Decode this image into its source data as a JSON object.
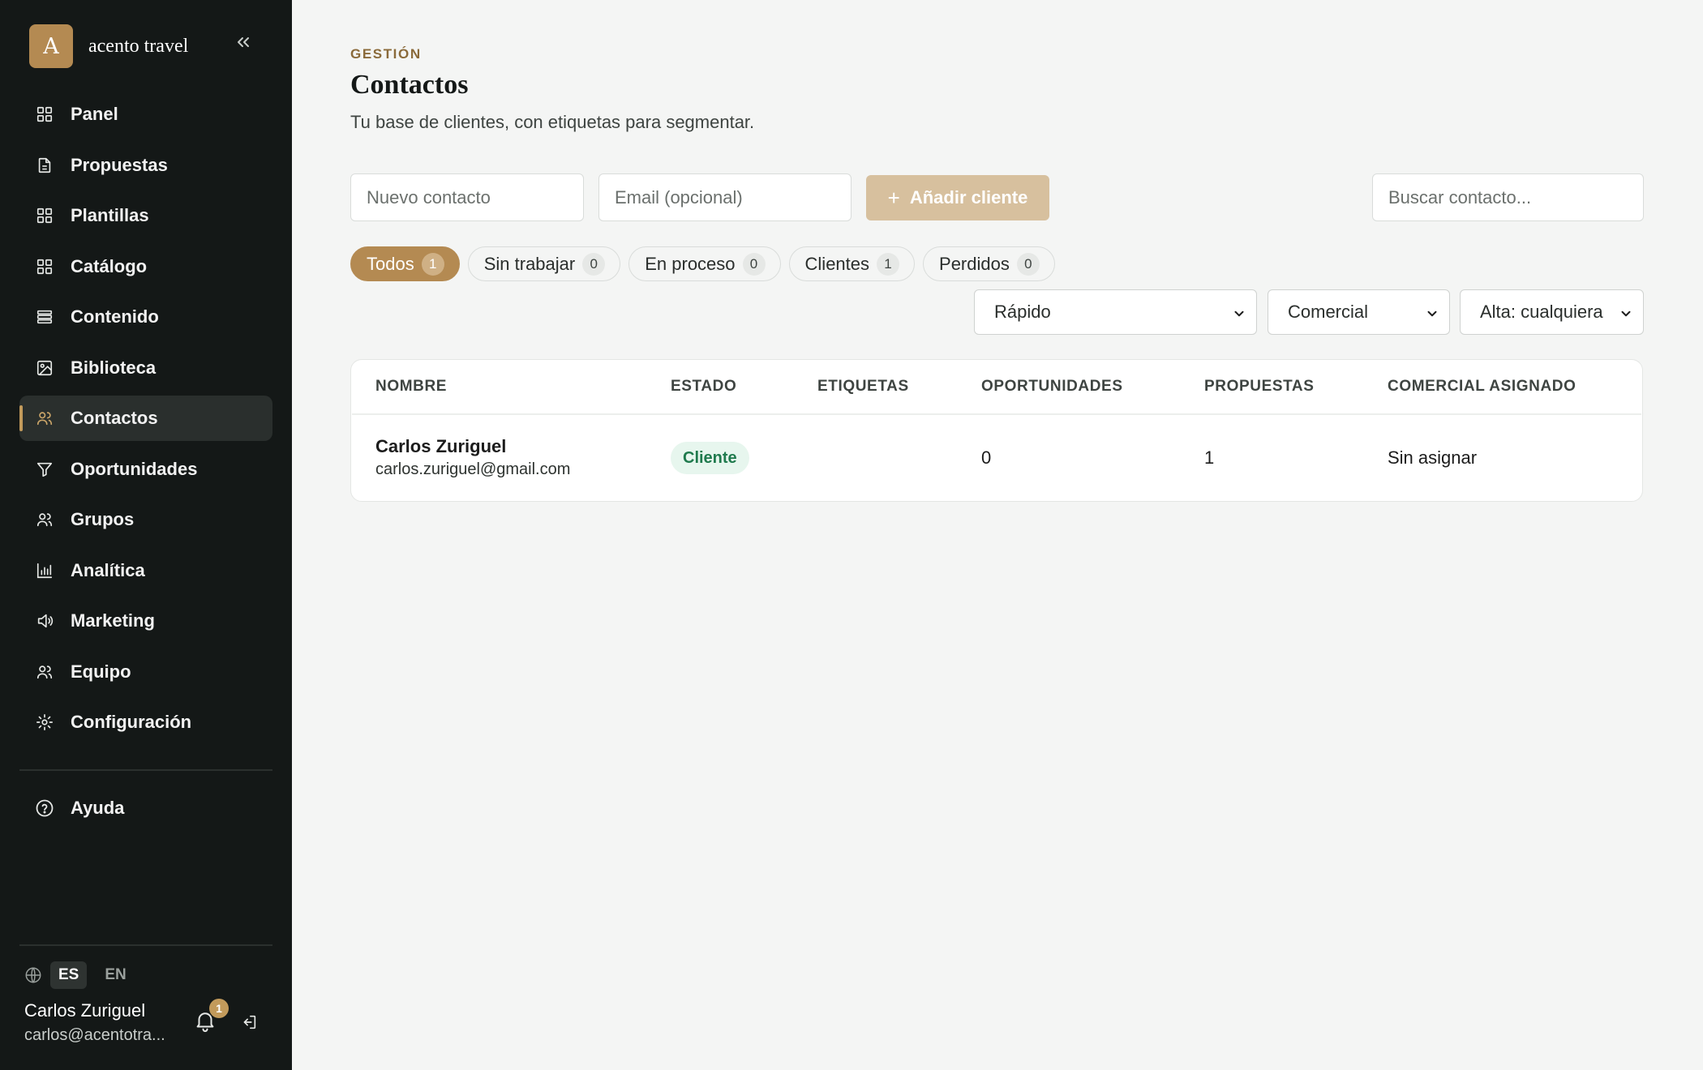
{
  "brand": {
    "logo_letter": "A",
    "name": "acento travel"
  },
  "nav": {
    "items": [
      {
        "label": "Panel",
        "icon": "grid-icon",
        "active": false
      },
      {
        "label": "Propuestas",
        "icon": "document-icon",
        "active": false
      },
      {
        "label": "Plantillas",
        "icon": "grid-icon",
        "active": false
      },
      {
        "label": "Catálogo",
        "icon": "grid-icon",
        "active": false
      },
      {
        "label": "Contenido",
        "icon": "layers-icon",
        "active": false
      },
      {
        "label": "Biblioteca",
        "icon": "image-icon",
        "active": false
      },
      {
        "label": "Contactos",
        "icon": "users-icon",
        "active": true
      },
      {
        "label": "Oportunidades",
        "icon": "filter-icon",
        "active": false
      },
      {
        "label": "Grupos",
        "icon": "users-icon",
        "active": false
      },
      {
        "label": "Analítica",
        "icon": "bar-chart-icon",
        "active": false
      },
      {
        "label": "Marketing",
        "icon": "megaphone-icon",
        "active": false
      },
      {
        "label": "Equipo",
        "icon": "users-icon",
        "active": false
      },
      {
        "label": "Configuración",
        "icon": "gear-icon",
        "active": false
      }
    ],
    "help": {
      "label": "Ayuda",
      "icon": "help-circle-icon"
    }
  },
  "lang": {
    "options": [
      "ES",
      "EN"
    ],
    "selected": "ES"
  },
  "user": {
    "name": "Carlos Zuriguel",
    "email": "carlos@acentotra...",
    "notifications": "1"
  },
  "page": {
    "eyebrow": "GESTIÓN",
    "title": "Contactos",
    "subtitle": "Tu base de clientes, con etiquetas para segmentar."
  },
  "form": {
    "name_placeholder": "Nuevo contacto",
    "email_placeholder": "Email (opcional)",
    "add_label": "Añadir cliente",
    "search_placeholder": "Buscar contacto..."
  },
  "filters": {
    "chips": [
      {
        "label": "Todos",
        "count": "1",
        "selected": true
      },
      {
        "label": "Sin trabajar",
        "count": "0",
        "selected": false
      },
      {
        "label": "En proceso",
        "count": "0",
        "selected": false
      },
      {
        "label": "Clientes",
        "count": "1",
        "selected": false
      },
      {
        "label": "Perdidos",
        "count": "0",
        "selected": false
      }
    ],
    "selects": [
      "Rápido",
      "Comercial",
      "Alta: cualquiera"
    ]
  },
  "table": {
    "headers": [
      "NOMBRE",
      "ESTADO",
      "ETIQUETAS",
      "OPORTUNIDADES",
      "PROPUESTAS",
      "COMERCIAL ASIGNADO"
    ],
    "rows": [
      {
        "name": "Carlos Zuriguel",
        "email": "carlos.zuriguel@gmail.com",
        "status": "Cliente",
        "tags": "",
        "opportunities": "0",
        "proposals": "1",
        "assigned": "Sin asignar"
      }
    ]
  },
  "colors": {
    "accent": "#b48a52",
    "sidebar_bg": "#141817",
    "page_bg": "#f4f5f4",
    "status_green": "#1f7a4d"
  }
}
